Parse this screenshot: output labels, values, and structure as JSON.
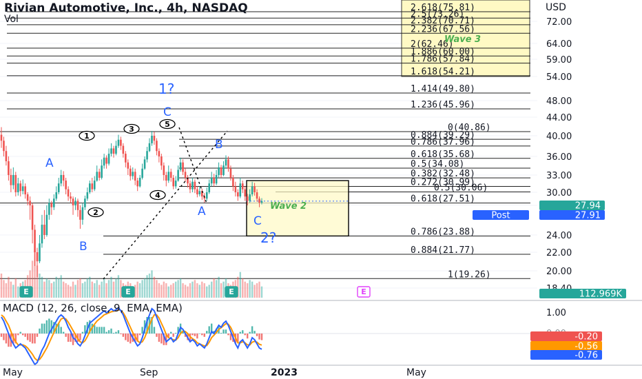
{
  "header": {
    "title": "Rivian Automotive, Inc., 4h, NASDAQ",
    "vol_label": "Vol",
    "currency": "USD",
    "macd_label": "MACD (12, 26, close, 9, EMA, EMA)"
  },
  "colors": {
    "up": "#26a69a",
    "down": "#ef5350",
    "macd_line": "#2962ff",
    "signal_line": "#ff9800",
    "fib_box": "#fff9c4",
    "wave_label": "#2962ff",
    "annotation_green": "#4caf50",
    "earnings_marker": "#26a69a",
    "earnings_future": "#e040fb"
  },
  "chart_data": {
    "type": "candlestick",
    "price_axis": {
      "ticks": [
        72.0,
        64.0,
        59.0,
        54.0,
        48.0,
        44.0,
        40.0,
        36.0,
        33.0,
        30.0,
        27.0,
        24.0,
        22.0,
        20.0,
        18.4
      ],
      "labels": [
        "72.00",
        "64.00",
        "59.00",
        "54.00",
        "48.00",
        "44.00",
        "40.00",
        "36.00",
        "33.00",
        "30.00",
        "",
        "24.00",
        "22.00",
        "20.00",
        "18.40"
      ]
    },
    "time_axis": {
      "labels": [
        "May",
        "Sep",
        "2023",
        "May"
      ],
      "positions": [
        0,
        4,
        8,
        12
      ]
    },
    "price_markers": [
      {
        "label": "27.94",
        "value": 27.94,
        "color": "#26a69a"
      },
      {
        "label": "Post",
        "value": 27.91,
        "color": "#2962ff"
      },
      {
        "label": "27.91",
        "value": 27.91,
        "color": "#2962ff"
      }
    ],
    "volume_marker": {
      "label": "112.969K",
      "color": "#26a69a"
    },
    "fib_extension_upper": [
      {
        "label": "2.618(75.81)",
        "value": 75.81
      },
      {
        "label": "2.5(73.26)",
        "value": 73.26
      },
      {
        "label": "2.382(70.71)",
        "value": 70.71
      },
      {
        "label": "2.236(67.56)",
        "value": 67.56
      },
      {
        "label": "2(62.46)",
        "value": 62.46
      },
      {
        "label": "1.886(60.00)",
        "value": 60.0
      },
      {
        "label": "1.786(57.84)",
        "value": 57.84
      },
      {
        "label": "1.618(54.21)",
        "value": 54.21
      },
      {
        "label": "1.414(49.80)",
        "value": 49.8
      },
      {
        "label": "1.236(45.96)",
        "value": 45.96
      }
    ],
    "fib_retracement_a": [
      {
        "label": "0(40.86)",
        "value": 40.86
      },
      {
        "label": "0.884(39.29)",
        "value": 39.29
      },
      {
        "label": "0.786(37.96)",
        "value": 37.96
      },
      {
        "label": "0.618(35.68)",
        "value": 35.68
      },
      {
        "label": "0.5(34.08)",
        "value": 34.08
      },
      {
        "label": "0.382(32.48)",
        "value": 32.48
      },
      {
        "label": "0.272(30.99)",
        "value": 30.99
      },
      {
        "label": "0.5(30.06)",
        "value": 30.06
      },
      {
        "label": "0.618(27.51)",
        "value": 27.51
      }
    ],
    "fib_retracement_b": [
      {
        "label": "0.786(23.88)",
        "value": 23.88
      },
      {
        "label": "0.884(21.77)",
        "value": 21.77
      },
      {
        "label": "1(19.26)",
        "value": 19.26
      }
    ],
    "wave_labels": [
      "A",
      "B",
      "1?",
      "C",
      "B",
      "A",
      "C",
      "2?"
    ],
    "circled_labels": [
      "1",
      "2",
      "3",
      "4",
      "5"
    ],
    "annotations": [
      "Wave 3",
      "Wave 2"
    ],
    "earnings_markers": [
      "E",
      "E",
      "E",
      "E"
    ],
    "candles": [
      [
        40.2,
        39.0,
        41.8,
        37.6
      ],
      [
        39.0,
        37.0,
        39.8,
        36.0
      ],
      [
        37.0,
        35.2,
        38.0,
        34.5
      ],
      [
        35.2,
        33.0,
        36.0,
        32.0
      ],
      [
        33.0,
        31.2,
        34.0,
        30.0
      ],
      [
        31.2,
        33.0,
        34.2,
        30.5
      ],
      [
        33.0,
        30.0,
        33.5,
        29.0
      ],
      [
        30.0,
        31.5,
        32.5,
        29.2
      ],
      [
        31.5,
        30.2,
        32.0,
        29.0
      ],
      [
        30.2,
        31.0,
        32.2,
        29.5
      ],
      [
        31.0,
        29.5,
        31.5,
        28.5
      ],
      [
        29.5,
        28.0,
        30.0,
        27.0
      ],
      [
        28.0,
        27.0,
        29.0,
        25.5
      ],
      [
        27.0,
        24.5,
        27.5,
        23.0
      ],
      [
        24.5,
        22.0,
        25.0,
        20.5
      ],
      [
        22.0,
        21.0,
        22.5,
        19.4
      ],
      [
        21.0,
        23.0,
        24.0,
        20.8
      ],
      [
        23.0,
        25.0,
        26.0,
        22.5
      ],
      [
        25.0,
        24.0,
        26.5,
        23.5
      ],
      [
        24.0,
        26.0,
        27.0,
        23.8
      ],
      [
        26.0,
        27.5,
        28.5,
        25.5
      ],
      [
        27.5,
        26.8,
        28.0,
        26.0
      ],
      [
        26.8,
        28.5,
        29.5,
        26.5
      ],
      [
        28.5,
        30.0,
        31.0,
        28.0
      ],
      [
        30.0,
        31.5,
        32.5,
        29.5
      ],
      [
        31.5,
        33.0,
        33.8,
        31.0
      ],
      [
        33.0,
        32.0,
        33.6,
        31.0
      ],
      [
        32.0,
        30.5,
        32.5,
        29.5
      ],
      [
        30.5,
        29.0,
        31.0,
        28.0
      ],
      [
        29.0,
        28.5,
        30.0,
        27.5
      ],
      [
        28.5,
        27.0,
        29.0,
        26.0
      ],
      [
        27.0,
        28.0,
        28.8,
        26.5
      ],
      [
        28.0,
        26.5,
        28.5,
        25.8
      ],
      [
        26.5,
        25.5,
        27.0,
        24.6
      ],
      [
        25.5,
        26.8,
        27.5,
        25.0
      ],
      [
        26.8,
        28.5,
        29.2,
        26.5
      ],
      [
        28.5,
        30.0,
        30.8,
        28.0
      ],
      [
        30.0,
        31.5,
        32.0,
        29.6
      ],
      [
        31.5,
        30.5,
        32.5,
        30.0
      ],
      [
        30.5,
        32.0,
        32.8,
        30.2
      ],
      [
        32.0,
        33.5,
        34.5,
        31.8
      ],
      [
        33.5,
        32.5,
        34.0,
        32.0
      ],
      [
        32.5,
        34.5,
        35.5,
        32.2
      ],
      [
        34.5,
        35.8,
        36.5,
        34.0
      ],
      [
        35.8,
        34.8,
        36.2,
        34.0
      ],
      [
        34.8,
        36.5,
        37.5,
        34.5
      ],
      [
        36.5,
        37.5,
        38.5,
        36.0
      ],
      [
        37.5,
        36.5,
        38.0,
        35.8
      ],
      [
        36.5,
        38.0,
        39.0,
        36.2
      ],
      [
        38.0,
        39.2,
        40.2,
        37.6
      ],
      [
        39.2,
        38.0,
        39.8,
        37.2
      ],
      [
        38.0,
        36.5,
        38.5,
        35.8
      ],
      [
        36.5,
        35.0,
        37.0,
        34.2
      ],
      [
        35.0,
        34.0,
        35.5,
        33.0
      ],
      [
        34.0,
        32.8,
        34.5,
        32.0
      ],
      [
        32.8,
        33.5,
        34.2,
        32.2
      ],
      [
        33.5,
        32.0,
        34.0,
        31.2
      ],
      [
        32.0,
        31.0,
        32.5,
        30.2
      ],
      [
        31.0,
        32.5,
        33.0,
        30.8
      ],
      [
        32.5,
        34.0,
        34.8,
        32.2
      ],
      [
        34.0,
        35.5,
        36.0,
        33.8
      ],
      [
        35.5,
        37.0,
        37.8,
        35.0
      ],
      [
        37.0,
        38.5,
        39.5,
        36.8
      ],
      [
        38.5,
        40.0,
        41.0,
        38.0
      ],
      [
        40.0,
        39.0,
        40.8,
        38.2
      ],
      [
        39.0,
        37.0,
        39.5,
        36.2
      ],
      [
        37.0,
        36.0,
        37.5,
        35.0
      ],
      [
        36.0,
        34.5,
        36.5,
        33.8
      ],
      [
        34.5,
        33.0,
        35.0,
        32.0
      ],
      [
        33.0,
        32.0,
        33.5,
        31.0
      ],
      [
        32.0,
        33.5,
        34.5,
        31.6
      ],
      [
        33.5,
        32.5,
        34.0,
        31.8
      ],
      [
        32.5,
        31.0,
        33.0,
        30.5
      ],
      [
        31.0,
        32.0,
        32.8,
        30.6
      ],
      [
        32.0,
        33.8,
        34.5,
        31.8
      ],
      [
        33.8,
        35.0,
        35.8,
        33.5
      ],
      [
        35.0,
        33.5,
        35.5,
        33.0
      ],
      [
        33.5,
        32.5,
        34.0,
        31.8
      ],
      [
        32.5,
        31.5,
        33.0,
        30.8
      ],
      [
        31.5,
        30.5,
        32.0,
        29.8
      ],
      [
        30.5,
        31.8,
        32.5,
        30.0
      ],
      [
        31.8,
        30.5,
        32.2,
        29.8
      ],
      [
        30.5,
        29.5,
        31.0,
        28.8
      ],
      [
        29.5,
        30.2,
        31.0,
        29.0
      ],
      [
        30.2,
        29.0,
        30.6,
        28.2
      ],
      [
        29.0,
        28.5,
        29.8,
        27.6
      ],
      [
        28.5,
        30.0,
        30.8,
        28.0
      ],
      [
        30.0,
        31.5,
        32.2,
        29.6
      ],
      [
        31.5,
        32.5,
        33.5,
        31.0
      ],
      [
        32.5,
        31.5,
        33.2,
        31.0
      ],
      [
        31.5,
        33.0,
        33.8,
        31.2
      ],
      [
        33.0,
        34.2,
        35.0,
        32.6
      ],
      [
        34.2,
        33.0,
        34.6,
        32.5
      ],
      [
        33.0,
        34.5,
        35.2,
        32.8
      ],
      [
        34.5,
        35.5,
        36.2,
        34.0
      ],
      [
        35.5,
        34.0,
        36.0,
        33.5
      ],
      [
        34.0,
        32.5,
        34.5,
        32.0
      ],
      [
        32.5,
        31.0,
        33.0,
        30.2
      ],
      [
        31.0,
        30.0,
        31.8,
        29.0
      ],
      [
        30.0,
        29.0,
        30.5,
        28.0
      ],
      [
        29.0,
        31.5,
        32.5,
        28.6
      ],
      [
        31.5,
        30.5,
        32.0,
        29.8
      ],
      [
        30.5,
        29.0,
        31.0,
        28.0
      ],
      [
        29.0,
        28.0,
        29.6,
        27.0
      ],
      [
        28.0,
        29.5,
        30.5,
        27.6
      ],
      [
        29.5,
        31.0,
        31.8,
        29.0
      ],
      [
        31.0,
        30.0,
        31.6,
        29.2
      ],
      [
        30.0,
        28.5,
        30.5,
        27.8
      ],
      [
        28.5,
        27.6,
        29.0,
        26.8
      ],
      [
        27.6,
        27.94,
        28.6,
        27.2
      ]
    ],
    "volume": [
      30,
      22,
      18,
      26,
      20,
      16,
      24,
      14,
      18,
      20,
      22,
      28,
      34,
      46,
      60,
      40,
      30,
      26,
      20,
      24,
      22,
      18,
      20,
      26,
      24,
      28,
      20,
      18,
      16,
      14,
      20,
      16,
      22,
      24,
      18,
      20,
      24,
      26,
      20,
      18,
      22,
      16,
      20,
      24,
      18,
      22,
      26,
      20,
      24,
      28,
      22,
      18,
      16,
      20,
      18,
      14,
      16,
      20,
      18,
      22,
      24,
      28,
      30,
      34,
      26,
      22,
      18,
      16,
      20,
      18,
      14,
      16,
      18,
      20,
      22,
      24,
      18,
      16,
      14,
      18,
      20,
      22,
      18,
      16,
      20,
      18,
      14,
      16,
      20,
      24,
      22,
      26,
      18,
      20,
      24,
      18,
      16,
      20,
      22,
      26,
      32,
      24,
      20,
      18,
      22,
      20,
      16,
      18,
      20,
      14
    ],
    "macd": [
      0.8,
      0.6,
      0.3,
      0.0,
      -0.3,
      -0.5,
      -0.7,
      -0.6,
      -0.5,
      -0.6,
      -0.7,
      -0.9,
      -1.1,
      -1.3,
      -1.5,
      -1.4,
      -1.1,
      -0.8,
      -0.6,
      -0.3,
      0.0,
      0.2,
      0.4,
      0.6,
      0.8,
      0.9,
      0.8,
      0.6,
      0.3,
      0.1,
      -0.2,
      -0.3,
      -0.5,
      -0.6,
      -0.4,
      -0.1,
      0.2,
      0.5,
      0.6,
      0.7,
      0.8,
      0.9,
      1.0,
      1.1,
      1.0,
      1.1,
      1.2,
      1.1,
      1.15,
      1.25,
      1.1,
      0.9,
      0.6,
      0.3,
      0.0,
      -0.2,
      -0.4,
      -0.6,
      -0.5,
      -0.2,
      0.2,
      0.6,
      0.9,
      1.2,
      1.1,
      0.8,
      0.5,
      0.2,
      -0.1,
      -0.4,
      -0.3,
      -0.2,
      -0.4,
      -0.3,
      0.0,
      0.3,
      0.2,
      0.0,
      -0.2,
      -0.4,
      -0.3,
      -0.4,
      -0.6,
      -0.5,
      -0.6,
      -0.7,
      -0.5,
      -0.2,
      0.1,
      0.0,
      0.2,
      0.4,
      0.3,
      0.5,
      0.6,
      0.4,
      0.1,
      -0.2,
      -0.5,
      -0.7,
      -0.4,
      -0.3,
      -0.5,
      -0.7,
      -0.5,
      -0.2,
      -0.3,
      -0.5,
      -0.7,
      -0.76
    ],
    "signal": [
      0.9,
      0.8,
      0.6,
      0.4,
      0.1,
      -0.2,
      -0.4,
      -0.55,
      -0.55,
      -0.55,
      -0.6,
      -0.7,
      -0.85,
      -1.0,
      -1.2,
      -1.3,
      -1.25,
      -1.1,
      -0.9,
      -0.7,
      -0.45,
      -0.2,
      0.05,
      0.3,
      0.5,
      0.7,
      0.75,
      0.7,
      0.55,
      0.35,
      0.15,
      -0.05,
      -0.25,
      -0.4,
      -0.45,
      -0.35,
      -0.15,
      0.1,
      0.3,
      0.45,
      0.6,
      0.7,
      0.8,
      0.9,
      0.95,
      1.0,
      1.05,
      1.08,
      1.1,
      1.15,
      1.12,
      1.0,
      0.8,
      0.55,
      0.3,
      0.05,
      -0.15,
      -0.35,
      -0.45,
      -0.4,
      -0.2,
      0.1,
      0.4,
      0.7,
      0.9,
      0.9,
      0.75,
      0.5,
      0.25,
      -0.05,
      -0.2,
      -0.25,
      -0.3,
      -0.32,
      -0.2,
      0.0,
      0.12,
      0.1,
      0.0,
      -0.15,
      -0.25,
      -0.32,
      -0.45,
      -0.5,
      -0.55,
      -0.6,
      -0.58,
      -0.42,
      -0.2,
      -0.08,
      0.05,
      0.2,
      0.28,
      0.38,
      0.48,
      0.45,
      0.3,
      0.05,
      -0.2,
      -0.45,
      -0.45,
      -0.4,
      -0.45,
      -0.55,
      -0.55,
      -0.42,
      -0.38,
      -0.42,
      -0.52,
      -0.56
    ],
    "macd_values": [
      {
        "label": "-0.20",
        "color": "#ef5350"
      },
      {
        "label": "-0.56",
        "color": "#ff9800"
      },
      {
        "label": "-0.76",
        "color": "#2962ff"
      }
    ],
    "macd_ticks": [
      "1.00",
      "0.00"
    ]
  }
}
